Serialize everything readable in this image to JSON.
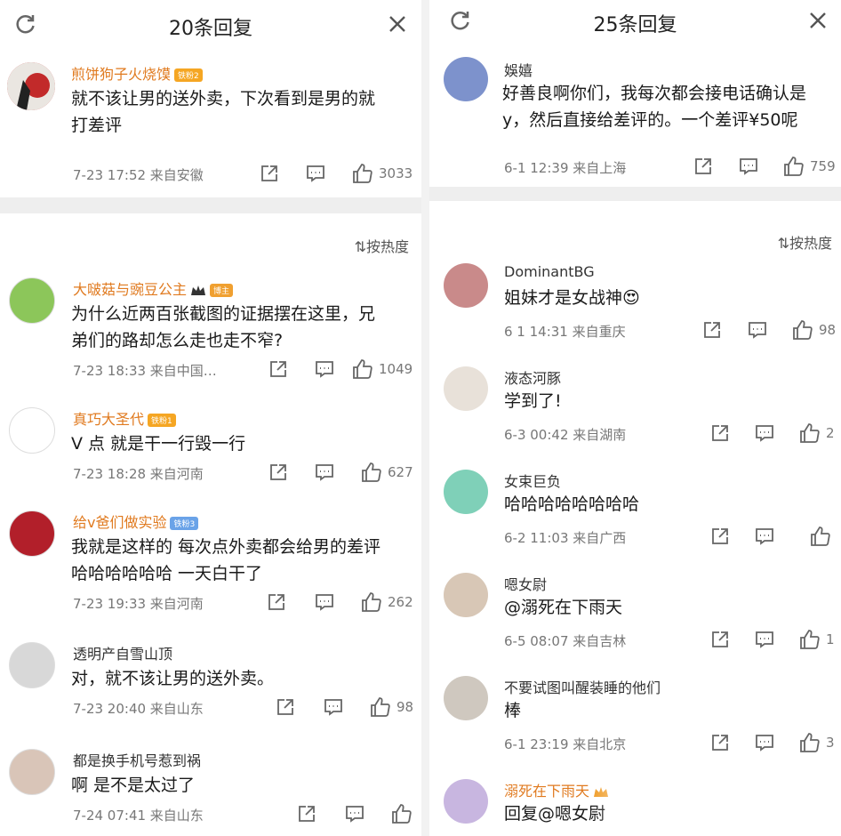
{
  "left": {
    "title": "20条回复",
    "sort_label": "按热度",
    "top": {
      "user": "煎饼狗子火烧馍",
      "badge": "铁粉2",
      "text_line1": "就不该让男的送外卖，下次看到是男的就",
      "text_line2": "打差评",
      "meta": "7-23 17:52  来自安徽",
      "likes": "3033"
    },
    "comments": [
      {
        "user": "大啵菇与豌豆公主",
        "badge": "博主",
        "line1": "为什么近两百张截图的证据摆在这里，兄",
        "line2": "弟们的路却怎么走也走不窄?",
        "meta": "7-23 18:33  来自中国…",
        "likes": "1049"
      },
      {
        "user": "真巧大圣代",
        "badge": "铁粉1",
        "line1": "V 点 就是干一行毁一行",
        "line2": "",
        "meta": "7-23 18:28  来自河南",
        "likes": "627"
      },
      {
        "user": "给v爸们做实验",
        "badge": "铁粉3",
        "line1": "我就是这样的 每次点外卖都会给男的差评",
        "line2": "哈哈哈哈哈哈 一天白干了",
        "meta": "7-23 19:33  来自河南",
        "likes": "262"
      },
      {
        "user": "透明产自雪山顶",
        "badge": "",
        "line1": "对，就不该让男的送外卖。",
        "line2": "",
        "meta": "7-23 20:40  来自山东",
        "likes": "98"
      },
      {
        "user": "都是换手机号惹到祸",
        "badge": "",
        "line1": "啊 是不是太过了",
        "line2": "",
        "meta": "7-24 07:41  来自山东",
        "likes": ""
      }
    ]
  },
  "right": {
    "title": "25条回复",
    "sort_label": "按热度",
    "top": {
      "user": "娛嬉",
      "text_line1": "好善良啊你们，我每次都会接电话确认是",
      "text_line2": "y，然后直接给差评的。一个差评¥50呢",
      "meta": "6-1 12:39  来自上海",
      "likes": "759"
    },
    "comments": [
      {
        "user": "DominantBG",
        "line1": "姐妹才是女战神😍",
        "meta": "6 1 14:31  来自重庆",
        "likes": "98"
      },
      {
        "user": "液态河豚",
        "line1": "学到了!",
        "meta": "6-3 00:42  来自湖南",
        "likes": "2"
      },
      {
        "user": "女束巨负",
        "line1": "哈哈哈哈哈哈哈哈",
        "meta": "6-2 11:03  来自广西",
        "likes": ""
      },
      {
        "user": "嗯女尉",
        "line1": "@溺死在下雨天",
        "meta": "6-5 08:07  来自吉林",
        "likes": "1"
      },
      {
        "user": "不要试图叫醒装睡的他们",
        "line1": "棒",
        "meta": "6-1 23:19  来自北京",
        "likes": "3"
      },
      {
        "user": "溺死在下雨天",
        "line1": "回复@嗯女尉",
        "meta": "",
        "likes": ""
      }
    ]
  }
}
